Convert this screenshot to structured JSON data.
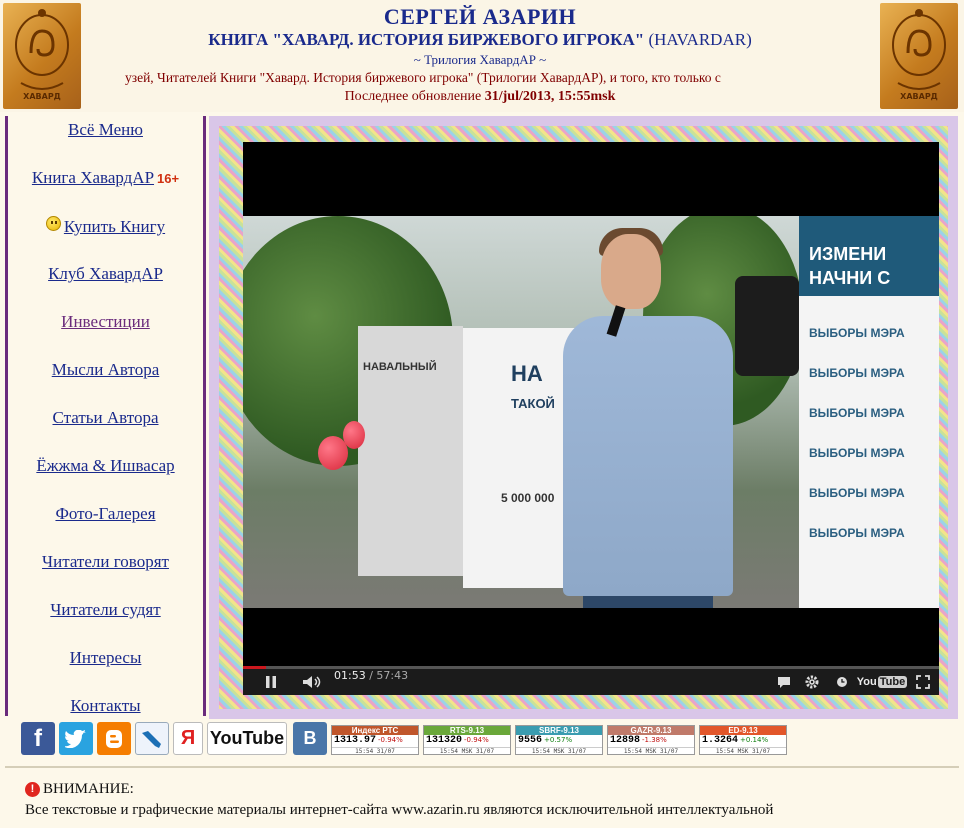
{
  "header": {
    "title": "СЕРГЕЙ АЗАРИН",
    "subtitle": "КНИГА \"ХАВАРД. ИСТОРИЯ БИРЖЕВОГО ИГРОКА\"",
    "subtitle_note": "(HAVARDAR)",
    "trilogy": "~ Трилогия ХавардАР ~",
    "marquee": "узей, Читателей Книги \"Хавард. История биржевого игрока\" (Трилогии ХавардАР), и того, кто только с",
    "updated_label": "Последнее обновление",
    "updated_value": "31/jul/2013, 15:55msk",
    "logo_text": "ХАВАРД"
  },
  "nav": {
    "menu": "Всё Меню",
    "book": "Книга ХавардАР",
    "book_badge": "16+",
    "buy": "Купить Книгу",
    "club": "Клуб ХавардАР",
    "investments": "Инвестиции",
    "thoughts": "Мысли Автора",
    "articles": "Статьи Автора",
    "yozhma": "Ёжжма & Ишвасар",
    "gallery": "Фото-Галерея",
    "readers_say": "Читатели говорят",
    "readers_judge": "Читатели судят",
    "interests": "Интересы",
    "contacts": "Контакты"
  },
  "video": {
    "current_time": "01:53",
    "separator": " / ",
    "duration": "57:43",
    "progress": 0.033,
    "scene_banner_line1": "ИЗМЕНИ",
    "scene_banner_line2": "НАЧНИ С",
    "scene_repeat": "ВЫБОРЫ МЭРА",
    "scene_stand_left": "НАВАЛЬНЫЙ",
    "scene_stand_right": "НА",
    "scene_stand_sub": "ТАКОЙ",
    "scene_number": "5 000 000",
    "youtube_label": "You",
    "youtube_label_box": "Tube"
  },
  "social": {
    "facebook": "f",
    "yandex": "Я",
    "youtube": "YouTube",
    "vk": "В"
  },
  "tickers": [
    {
      "name": "Индекс РТС",
      "value": "1313.97",
      "change": "-0.94%",
      "date": "15:54 31/07",
      "color": "#c0562b"
    },
    {
      "name": "RTS-9.13",
      "value": "131320",
      "change": "-0.94%",
      "date": "15:54 MSK 31/07",
      "color": "#6aa83a"
    },
    {
      "name": "SBRF-9.13",
      "value": "9556",
      "change": "+0.57%",
      "date": "15:54 MSK 31/07",
      "color": "#3a9cb0"
    },
    {
      "name": "GAZR-9.13",
      "value": "12898",
      "change": "-1.38%",
      "date": "15:54 MSK 31/07",
      "color": "#c07a6a"
    },
    {
      "name": "ED-9.13",
      "value": "1.3264",
      "change": "+0.14%",
      "date": "15:54 MSK 31/07",
      "color": "#e2562a"
    }
  ],
  "notice": {
    "icon": "!",
    "heading": "ВНИМАНИЕ:",
    "body": "Все текстовые и графические материалы интернет-сайта www.azarin.ru являются исключительной интеллектуальной"
  }
}
